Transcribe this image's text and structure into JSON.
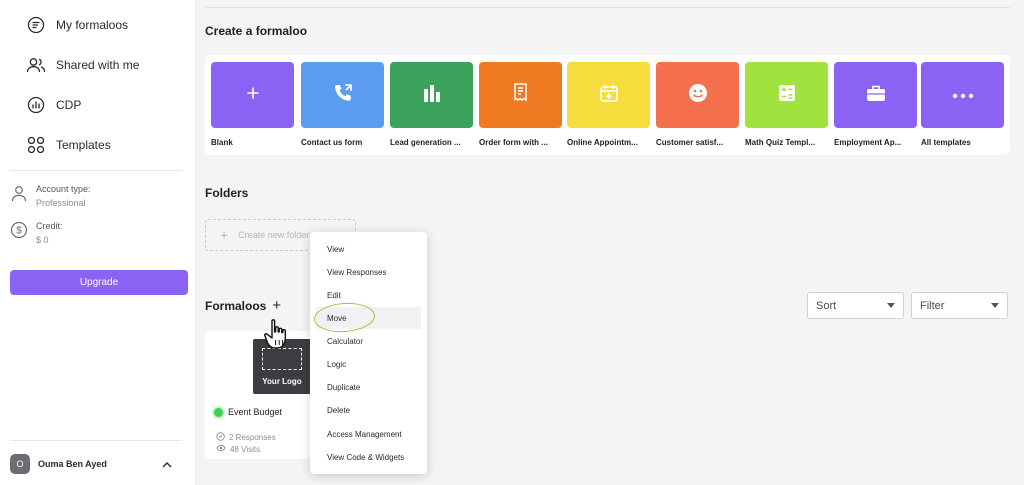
{
  "sidebar": {
    "nav": [
      {
        "label": "My formaloos",
        "icon": "formaloo-icon"
      },
      {
        "label": "Shared with me",
        "icon": "users-icon"
      },
      {
        "label": "CDP",
        "icon": "chart-icon"
      },
      {
        "label": "Templates",
        "icon": "grid-icon"
      }
    ],
    "account_type_label": "Account type:",
    "account_type_value": "Professional",
    "credit_label": "Credit:",
    "credit_value": "$ 0",
    "upgrade_label": "Upgrade",
    "user_initial": "O",
    "user_name": "Ouma Ben Ayed"
  },
  "main": {
    "create_title": "Create a formaloo",
    "templates": [
      {
        "label": "Blank",
        "color": "#8a63f5",
        "icon": "plus-icon"
      },
      {
        "label": "Contact us form",
        "color": "#5b9cf0",
        "icon": "phone-icon"
      },
      {
        "label": "Lead generation ...",
        "color": "#3ba35c",
        "icon": "bar-chart-icon"
      },
      {
        "label": "Order form with ...",
        "color": "#f07a22",
        "icon": "receipt-icon"
      },
      {
        "label": "Online Appointm...",
        "color": "#f6dc3c",
        "icon": "calendar-icon"
      },
      {
        "label": "Customer satisf...",
        "color": "#f5704f",
        "icon": "smiley-icon"
      },
      {
        "label": "Math Quiz Templ...",
        "color": "#a2e23f",
        "icon": "calculator-icon"
      },
      {
        "label": "Employment Ap...",
        "color": "#8a63f5",
        "icon": "briefcase-icon"
      },
      {
        "label": "All templates",
        "color": "#8a63f5",
        "icon": "more-icon"
      }
    ],
    "folders_title": "Folders",
    "new_folder_label": "Create new folder",
    "formaloos_title": "Formaloos",
    "sort_label": "Sort",
    "filter_label": "Filter",
    "card": {
      "logo_text": "Your Logo",
      "name": "Event Budget",
      "responses": "2 Responses",
      "visits": "48 Visits",
      "status_color": "#3ecf55"
    }
  },
  "context_menu": {
    "items": [
      "View",
      "View Responses",
      "Edit",
      "Move",
      "Calculator",
      "Logic",
      "Duplicate",
      "Delete",
      "Access Management",
      "View Code & Widgets"
    ],
    "active": "Move"
  }
}
